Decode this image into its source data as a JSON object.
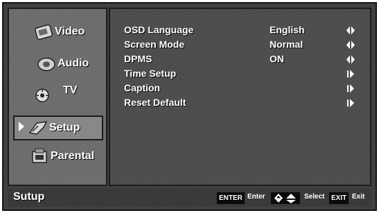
{
  "sidebar": {
    "items": [
      {
        "label": "Video",
        "icon": "video-icon"
      },
      {
        "label": "Audio",
        "icon": "audio-icon"
      },
      {
        "label": "TV",
        "icon": "tv-icon"
      },
      {
        "label": "Setup",
        "icon": "setup-icon",
        "selected": true
      },
      {
        "label": "Parental",
        "icon": "parental-icon"
      }
    ]
  },
  "settings": [
    {
      "label": "OSD Language",
      "value": "English",
      "arrow": "left-right-arrow-icon"
    },
    {
      "label": "Screen Mode",
      "value": "Normal",
      "arrow": "left-right-arrow-icon"
    },
    {
      "label": "DPMS",
      "value": "ON",
      "arrow": "left-right-arrow-icon"
    },
    {
      "label": "Time Setup",
      "value": "",
      "arrow": "enter-arrow-icon"
    },
    {
      "label": "Caption",
      "value": "",
      "arrow": "enter-arrow-icon"
    },
    {
      "label": "Reset Default",
      "value": "",
      "arrow": "enter-arrow-icon"
    }
  ],
  "footer": {
    "title": "Sutup",
    "enter_key": "ENTER",
    "enter_text": "Enter",
    "select_text": "Select",
    "exit_key": "EXIT",
    "exit_text": "Exit"
  },
  "colors": {
    "text": "#ffffff",
    "panel": "#4a4a4a",
    "sidebar": "#6a6a6a"
  }
}
